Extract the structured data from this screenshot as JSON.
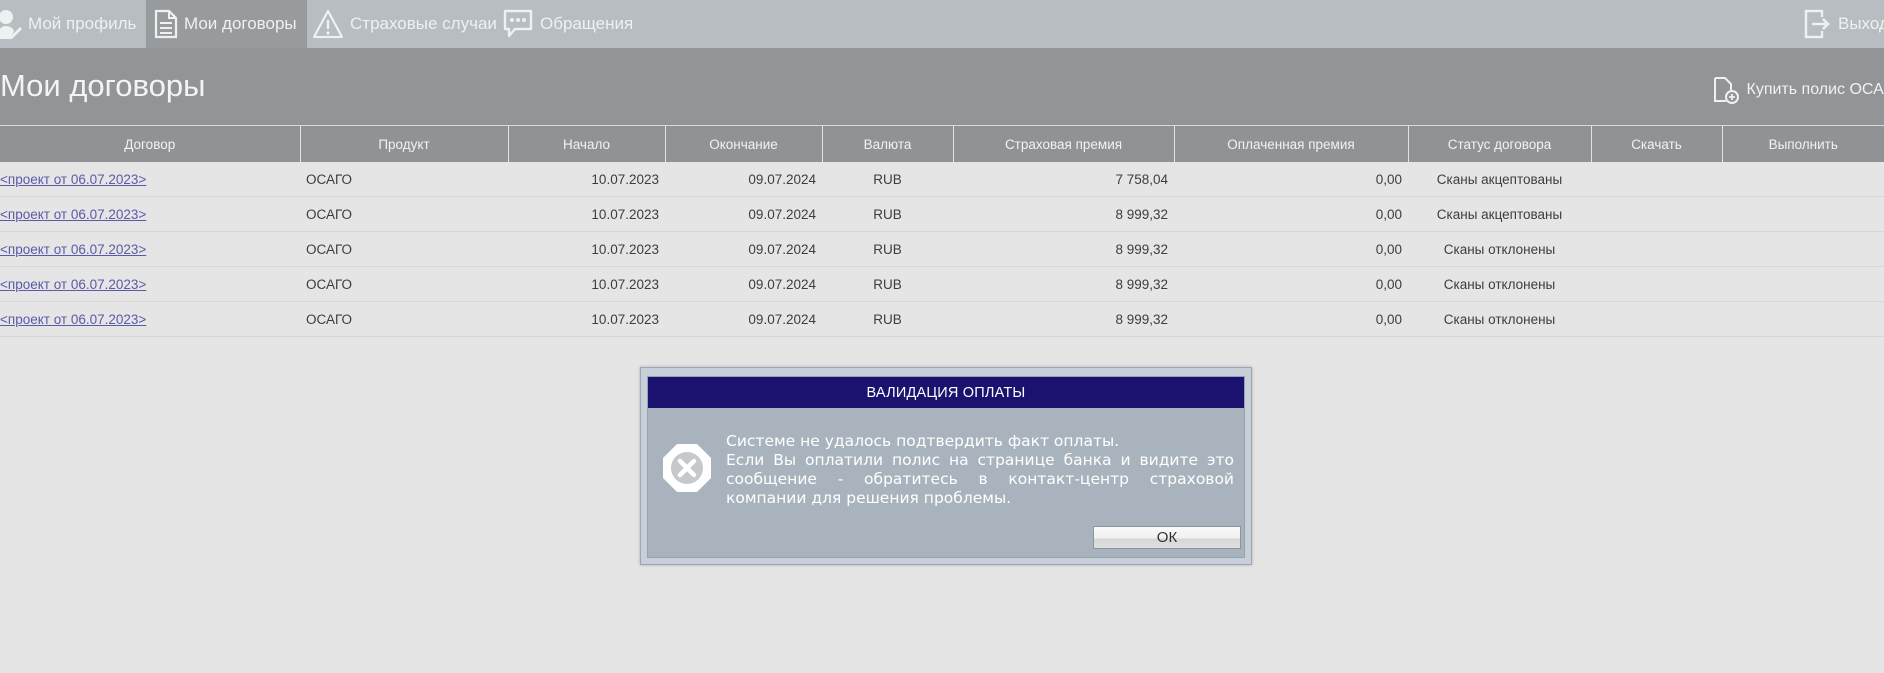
{
  "nav": {
    "profile": "Мой профиль",
    "contracts": "Мои договоры",
    "cases": "Страховые случаи",
    "appeals": "Обращения",
    "logout": "Выход"
  },
  "page": {
    "title": "Мои договоры",
    "buy_label": "Купить полис ОСАГО"
  },
  "table": {
    "headers": {
      "contract": "Договор",
      "product": "Продукт",
      "start": "Начало",
      "end": "Окончание",
      "currency": "Валюта",
      "premium": "Страховая премия",
      "paid": "Оплаченная премия",
      "status": "Статус договора",
      "download": "Скачать",
      "execute": "Выполнить"
    },
    "rows": [
      {
        "contract": "<проект от 06.07.2023>",
        "product": "ОСАГО",
        "start": "10.07.2023",
        "end": "09.07.2024",
        "currency": "RUB",
        "premium": "7 758,04",
        "paid": "0,00",
        "status": "Сканы акцептованы"
      },
      {
        "contract": "<проект от 06.07.2023>",
        "product": "ОСАГО",
        "start": "10.07.2023",
        "end": "09.07.2024",
        "currency": "RUB",
        "premium": "8 999,32",
        "paid": "0,00",
        "status": "Сканы акцептованы"
      },
      {
        "contract": "<проект от 06.07.2023>",
        "product": "ОСАГО",
        "start": "10.07.2023",
        "end": "09.07.2024",
        "currency": "RUB",
        "premium": "8 999,32",
        "paid": "0,00",
        "status": "Сканы отклонены"
      },
      {
        "contract": "<проект от 06.07.2023>",
        "product": "ОСАГО",
        "start": "10.07.2023",
        "end": "09.07.2024",
        "currency": "RUB",
        "premium": "8 999,32",
        "paid": "0,00",
        "status": "Сканы отклонены"
      },
      {
        "contract": "<проект от 06.07.2023>",
        "product": "ОСАГО",
        "start": "10.07.2023",
        "end": "09.07.2024",
        "currency": "RUB",
        "premium": "8 999,32",
        "paid": "0,00",
        "status": "Сканы отклонены"
      }
    ]
  },
  "dialog": {
    "title": "ВАЛИДАЦИЯ ОПЛАТЫ",
    "line1": "Системе не удалось подтвердить факт оплаты.",
    "line2": "Если Вы оплатили полис на странице банка и видите это сообщение - обратитесь в контакт-центр страховой компании для решения проблемы.",
    "ok_label": "ОК"
  },
  "icons": {
    "profile": "user-edit-icon",
    "contracts": "document-icon",
    "cases": "warning-icon",
    "appeals": "chat-icon",
    "logout": "exit-icon",
    "buy": "document-add-icon",
    "error": "error-octagon-icon"
  },
  "colors": {
    "dialog_title_bg": "#1b1270",
    "nav_bg": "#b7bdc0",
    "active_tab": "#979b9e",
    "header_band": "#929598",
    "link": "#5b5aa8"
  }
}
